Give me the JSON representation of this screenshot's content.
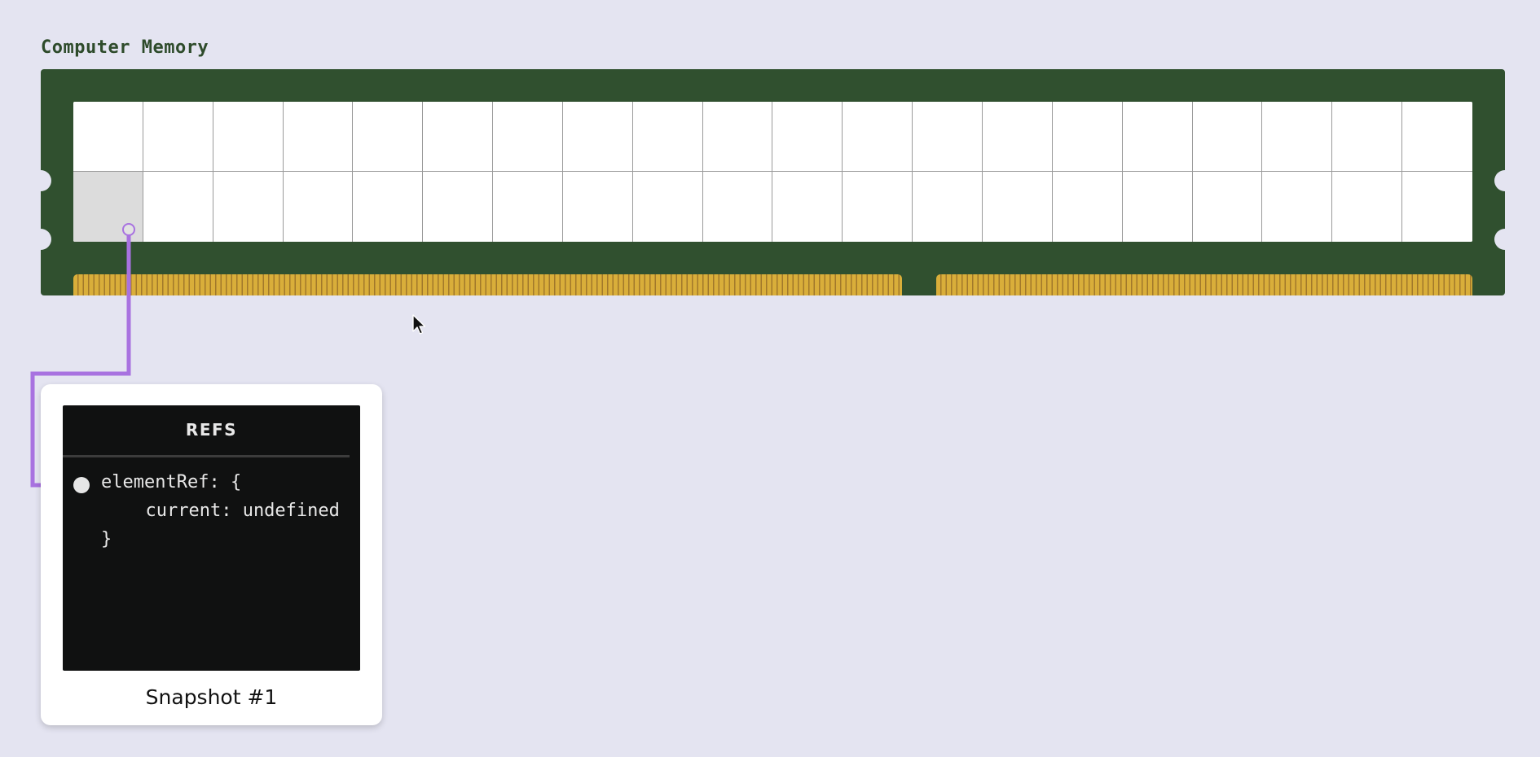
{
  "memory": {
    "title": "Computer Memory",
    "columns": 20,
    "rows": 2,
    "active_cell": {
      "row": 2,
      "column": 1
    }
  },
  "snapshot": {
    "panel_title": "REFS",
    "code_lines": [
      "elementRef: {",
      "  current: undefined",
      "}"
    ],
    "label": "Snapshot #1"
  },
  "colors": {
    "background": "#e4e4f1",
    "board": "#30502f",
    "contacts": "#d9ae3a",
    "pointer_line": "#a872e0",
    "panel_bg": "#101111"
  },
  "icons": {
    "cursor": "arrow-cursor-icon",
    "pointer_endpoint": "pointer-dot-icon"
  }
}
